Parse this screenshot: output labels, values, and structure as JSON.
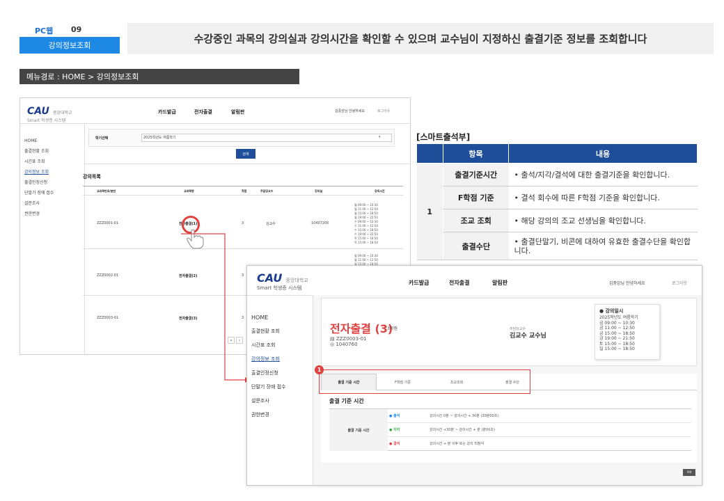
{
  "header": {
    "pc_tag": "PC웹",
    "page_num": "09",
    "section_title": "강의정보조회",
    "description": "수강중인 과목의 강의실과 강의시간을 확인할 수 있으며 교수님이 지정하신 출결기준 정보를 조회합니다",
    "menu_path": "메뉴경로 : HOME > 강의정보조회"
  },
  "app": {
    "logo_mark": "CAU",
    "logo_univ": "중앙대학교",
    "logo_system": "Smart 학생증 시스템",
    "nav": [
      "카드발급",
      "전자출결",
      "알림판"
    ],
    "greeting": "김중앙님 안녕하세요",
    "logout": "로그아웃",
    "sidebar": [
      "HOME",
      "출결현황 조회",
      "시간표 조회",
      "강의정보 조회",
      "출결인정신청",
      "단말기 장애 접수",
      "설문조사",
      "권한변경"
    ]
  },
  "bg": {
    "semester_label": "학기선택",
    "semester_value": "2025학년도 여름학기",
    "search_btn": "검색",
    "list_title": "강의목록",
    "cols": [
      "교과목번호/분반",
      "교과목명",
      "학점",
      "주담당교수",
      "강의실",
      "강의시간"
    ],
    "rows": [
      {
        "code": "ZZZ0001-01",
        "name": "전자출결(1)",
        "credit": "3",
        "prof": "김교수",
        "room": "10407200",
        "times": [
          "월 09:00 ~ 10:30",
          "월 11:00 ~ 12:50",
          "월 15:00 ~ 18:50",
          "월 19:00 ~ 22:50",
          "수 09:00 ~ 10:30",
          "수 11:00 ~ 12:50",
          "수 15:00 ~ 18:50",
          "수 19:00 ~ 22:50",
          "목 15:00 ~ 18:50",
          "목 15:00 ~ 18:50"
        ]
      },
      {
        "code": "ZZZ0002-01",
        "name": "전자출결(2)",
        "credit": "3",
        "prof": "",
        "room": "",
        "times": [
          "월 09:00 ~ 10:30",
          "월 11:00 ~ 12:50",
          "월 15:00 ~ 18:50"
        ]
      },
      {
        "code": "ZZZ0003-01",
        "name": "전자출결(3)",
        "credit": "3",
        "prof": "",
        "room": "",
        "times": []
      }
    ],
    "pager": [
      "«",
      "‹"
    ]
  },
  "smart": {
    "title": "[스마트출석부]",
    "headers": [
      "항목",
      "내용"
    ],
    "num": "1",
    "rows": [
      {
        "item": "출결기준시간",
        "content": "• 출석/지각/결석에 대한 출결기준을 확인합니다."
      },
      {
        "item": "F학점 기준",
        "content": "• 결석 회수에 따른 F학점 기준을 확인합니다."
      },
      {
        "item": "조교 조회",
        "content": "• 해당 강의의 조교 선생님을 확인합니다."
      },
      {
        "item": "출결수단",
        "content": "• 출결단말기, 비콘에 대하여 유효한 출결수단을 확인합니다."
      }
    ]
  },
  "fg": {
    "course_title": "전자출결 (3)",
    "credit": "3학점",
    "code": "ZZZ0003-01",
    "room": "1040760",
    "prof_label": "주담당교수",
    "prof": "김교수 교수님",
    "schedule_title": "강의일시",
    "schedule": [
      "2025학년도 여름학기",
      "금 09:00 ~ 10:30",
      "금 11:00 ~ 12:50",
      "금 15:00 ~ 18:50",
      "금 19:00 ~ 21:50",
      "토 15:00 ~ 18:50",
      "일 15:00 ~ 18:50"
    ],
    "tabs": [
      "출결 기준 시간",
      "F학점 기준",
      "조교조회",
      "출결 수단"
    ],
    "section_title": "출결 기준 시간",
    "criteria_label": "출결 기준 시간",
    "criteria": [
      {
        "status": "출석",
        "color": "#1e88e5",
        "rule": "강의시간 0분 ~ 강의시간 + 30분 (30분00초)"
      },
      {
        "status": "지각",
        "color": "#3aa845",
        "rule": "강의시간 +30분 ~ 강의시간 + 분 (분00초)"
      },
      {
        "status": "결석",
        "color": "#e04040",
        "rule": "강의시간 + 분 이후 또는 강의 미참석"
      }
    ],
    "list_btn": "목록"
  },
  "badge": "1"
}
